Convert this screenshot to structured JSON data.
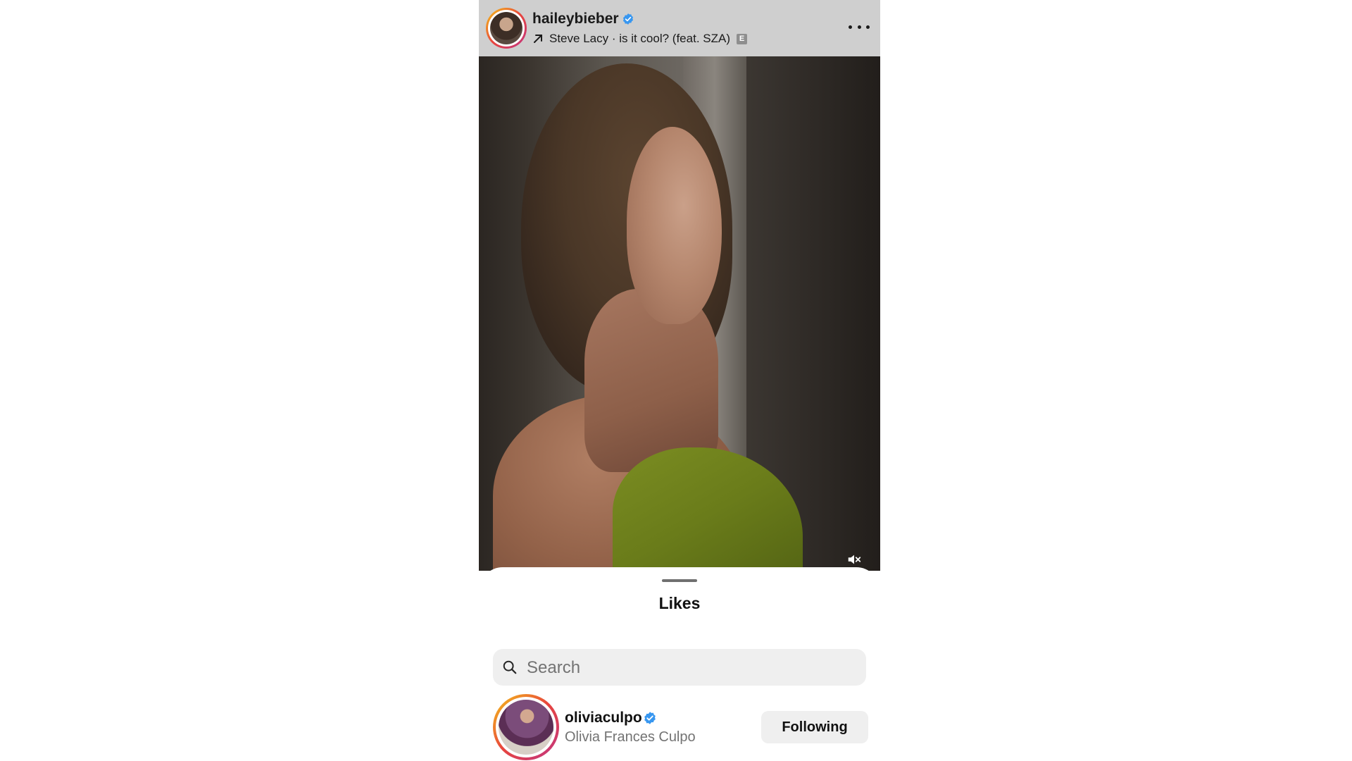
{
  "post": {
    "username": "haileybieber",
    "verified": true,
    "music": {
      "artist_track": "Steve Lacy · is it cool? (feat. SZA)",
      "explicit_badge": "E"
    },
    "more_icon": "more-horizontal-icon",
    "mute_icon": "speaker-muted-icon"
  },
  "likes_sheet": {
    "title": "Likes",
    "search": {
      "placeholder": "Search",
      "value": ""
    },
    "users": [
      {
        "username": "oliviaculpo",
        "verified": true,
        "full_name": "Olivia Frances Culpo",
        "button_label": "Following"
      }
    ]
  },
  "colors": {
    "verified_blue": "#3897f0",
    "story_ring_start": "#f5c518",
    "story_ring_end": "#c13584",
    "button_bg": "#efefef"
  }
}
